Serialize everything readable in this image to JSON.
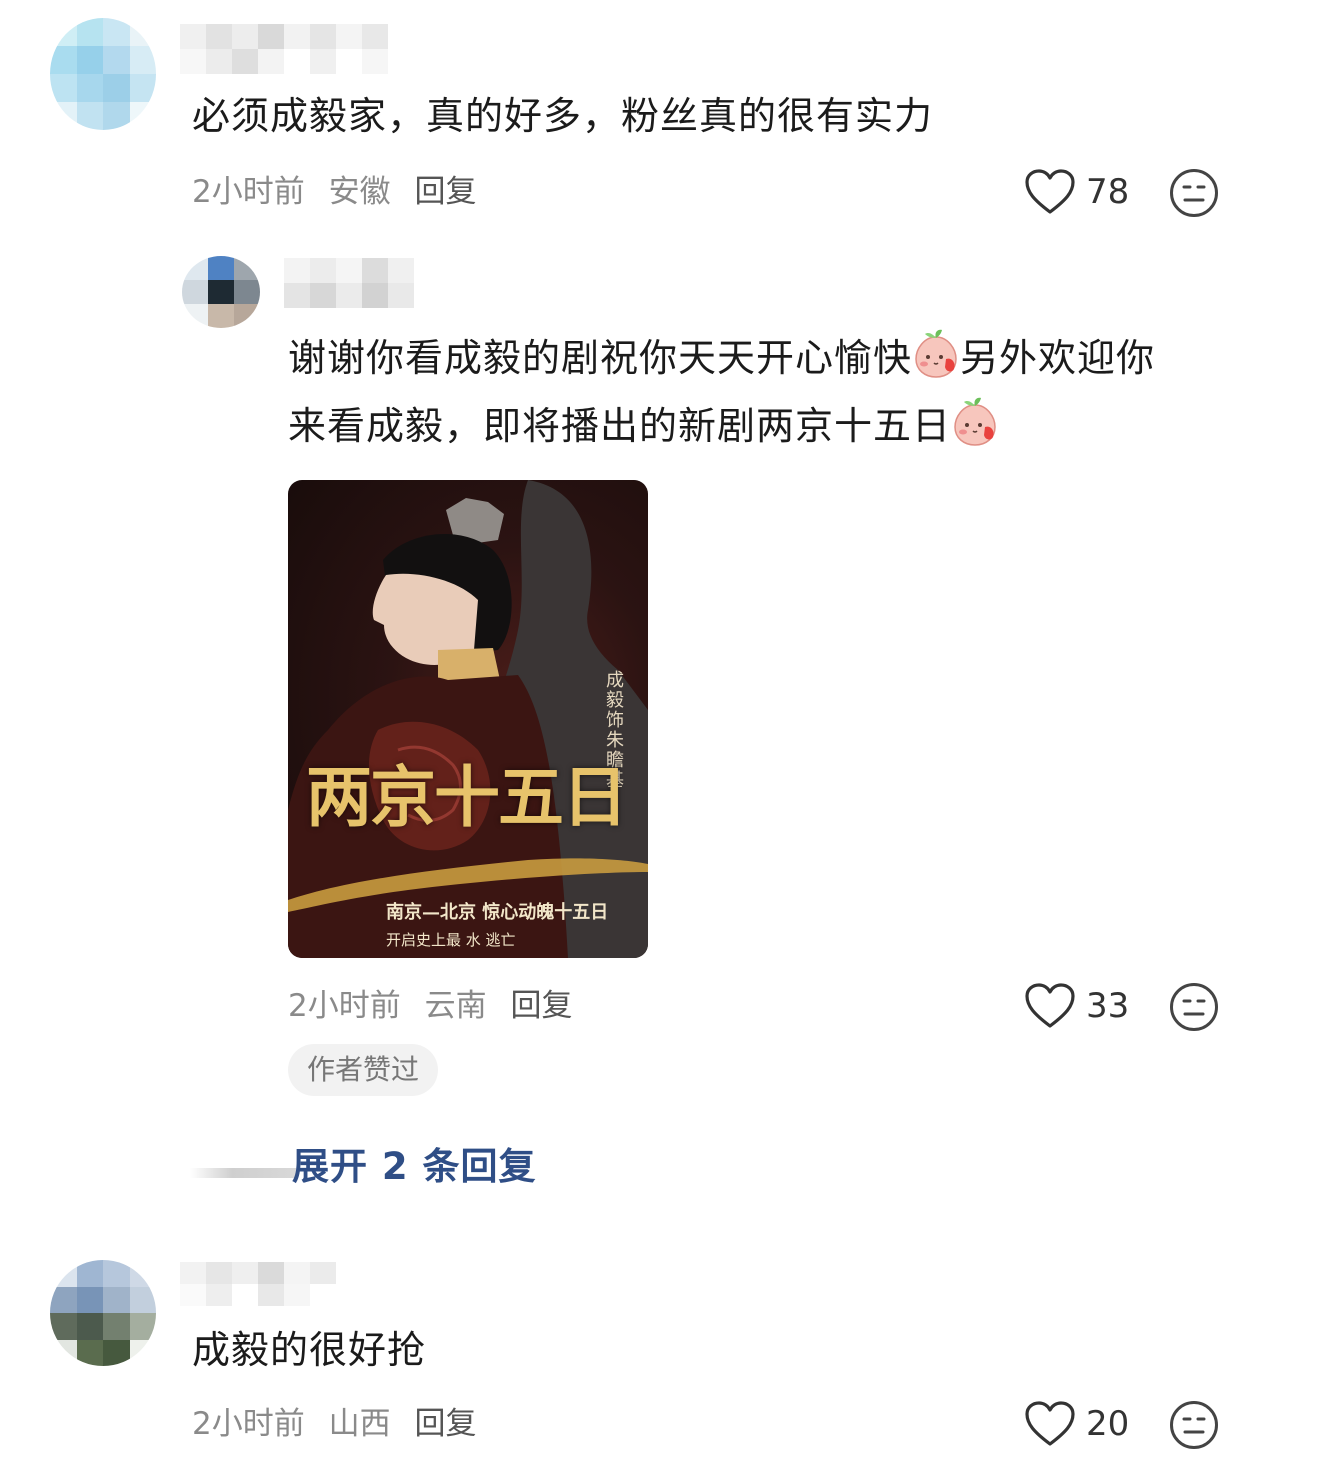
{
  "comments": [
    {
      "text": "必须成毅家，真的好多，粉丝真的很有实力",
      "time": "2小时前",
      "location": "安徽",
      "reply_label": "回复",
      "likes": "78"
    },
    {
      "text_line1": "谢谢你看成毅的剧祝你天天开心愉快",
      "text_line1b": "另外欢迎你",
      "text_line2": "来看成毅，即将播出的新剧两京十五日",
      "emoji_name": "blushing-peach-emoji",
      "time": "2小时前",
      "location": "云南",
      "reply_label": "回复",
      "likes": "33",
      "badge": "作者赞过",
      "poster": {
        "title": "两京十五日",
        "credit": "成毅饰朱瞻基",
        "tagline1": "南京—北京 惊心动魄十五日",
        "tagline2": "开启史上最 水 逃亡"
      }
    },
    {
      "text": "成毅的很好抢",
      "time": "2小时前",
      "location": "山西",
      "reply_label": "回复",
      "likes": "20"
    }
  ],
  "expand_replies": "展开 2 条回复",
  "colors": {
    "link": "#2f4e86",
    "meta": "#8a8a8a"
  },
  "icons": [
    "heart-outline-icon",
    "neutral-face-icon"
  ]
}
